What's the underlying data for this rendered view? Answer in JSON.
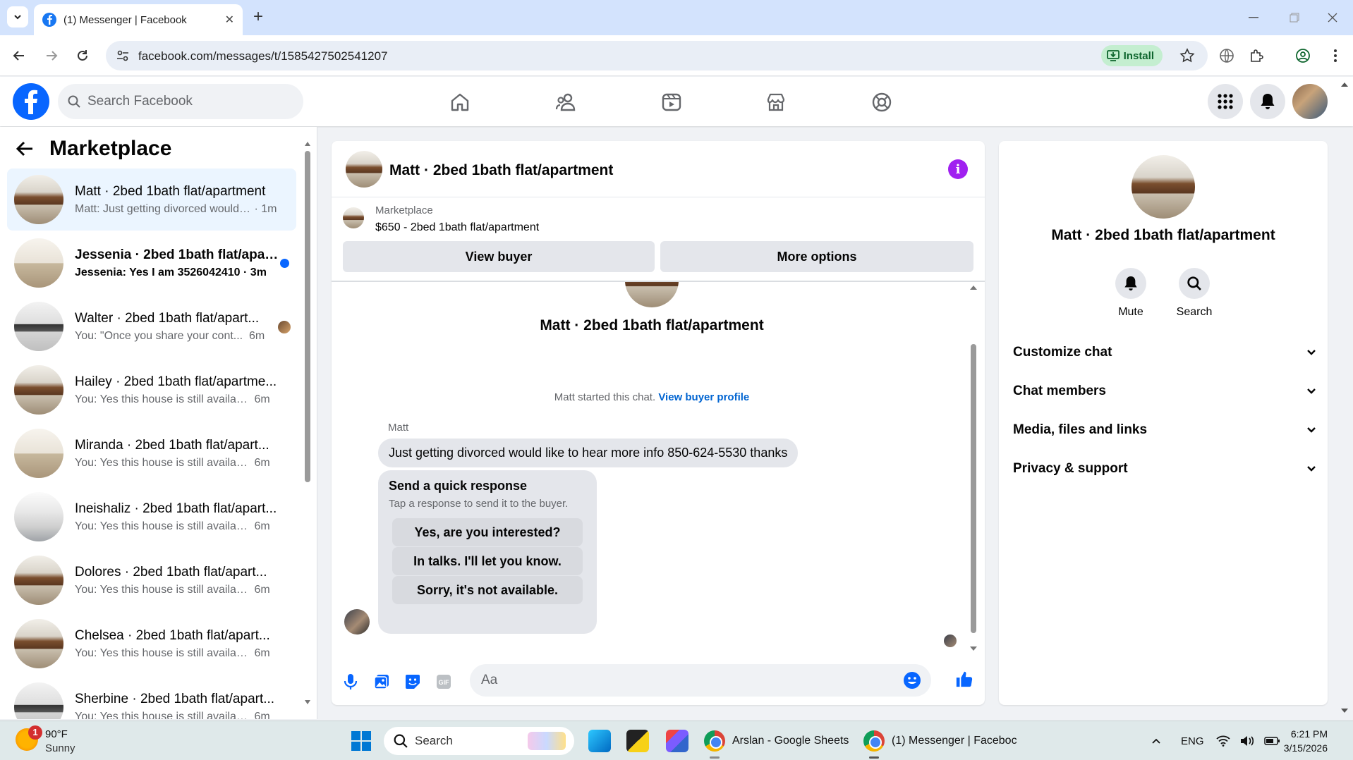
{
  "browser": {
    "tab_title": "(1) Messenger | Facebook",
    "url": "facebook.com/messages/t/1585427502541207",
    "install_label": "Install"
  },
  "fb": {
    "search_placeholder": "Search Facebook"
  },
  "sidebar": {
    "title": "Marketplace",
    "conversations": [
      {
        "name": "Matt · 2bed 1bath flat/apartment",
        "preview": "Matt: Just getting divorced would l...",
        "time": "1m",
        "active": true,
        "unread": false
      },
      {
        "name": "Jessenia · 2bed 1bath flat/apar...",
        "preview": "Jessenia: Yes I am 3526042410",
        "time": "3m",
        "active": false,
        "unread": true
      },
      {
        "name": "Walter · 2bed 1bath flat/apart...",
        "preview": "You: \"Once you share your cont...",
        "time": "6m",
        "active": false,
        "unread": false
      },
      {
        "name": "Hailey · 2bed 1bath flat/apartme...",
        "preview": "You: Yes this house is still available ...",
        "time": "6m",
        "active": false,
        "unread": false
      },
      {
        "name": "Miranda · 2bed 1bath flat/apart...",
        "preview": "You: Yes this house is still available ...",
        "time": "6m",
        "active": false,
        "unread": false
      },
      {
        "name": "Ineishaliz · 2bed 1bath flat/apart...",
        "preview": "You: Yes this house is still available ...",
        "time": "6m",
        "active": false,
        "unread": false
      },
      {
        "name": "Dolores · 2bed 1bath flat/apart...",
        "preview": "You: Yes this house is still available ...",
        "time": "6m",
        "active": false,
        "unread": false
      },
      {
        "name": "Chelsea · 2bed 1bath flat/apart...",
        "preview": "You: Yes this house is still available ...",
        "time": "6m",
        "active": false,
        "unread": false
      },
      {
        "name": "Sherbine · 2bed 1bath flat/apart...",
        "preview": "You: Yes this house is still available ...",
        "time": "6m",
        "active": false,
        "unread": false
      }
    ]
  },
  "chat": {
    "title": "Matt · 2bed 1bath flat/apartment",
    "marketplace_label": "Marketplace",
    "listing": "$650 - 2bed 1bath flat/apartment",
    "view_buyer": "View buyer",
    "more_options": "More options",
    "started_text": "Matt started this chat.",
    "view_buyer_profile": "View buyer profile",
    "sender": "Matt",
    "message": "Just getting divorced would like to hear more info 850-624-5530 thanks",
    "quick_title": "Send a quick response",
    "quick_sub": "Tap a response to send it to the buyer.",
    "quick_responses": [
      "Yes, are you interested?",
      "In talks. I'll let you know.",
      "Sorry, it's not available."
    ],
    "input_placeholder": "Aa"
  },
  "info": {
    "name": "Matt · 2bed 1bath flat/apartment",
    "mute": "Mute",
    "search": "Search",
    "sections": [
      "Customize chat",
      "Chat members",
      "Media, files and links",
      "Privacy & support"
    ]
  },
  "taskbar": {
    "temp": "90°F",
    "condition": "Sunny",
    "weather_badge": "1",
    "search": "Search",
    "app1": "Arslan - Google Sheets",
    "app2": "(1) Messenger | Faceboc",
    "lang": "ENG",
    "time": "6:21 PM",
    "date": "3/15/2026"
  },
  "colors": {
    "fb_blue": "#0866ff",
    "info_purple": "#a020f0",
    "active_bg": "#ebf5ff"
  }
}
